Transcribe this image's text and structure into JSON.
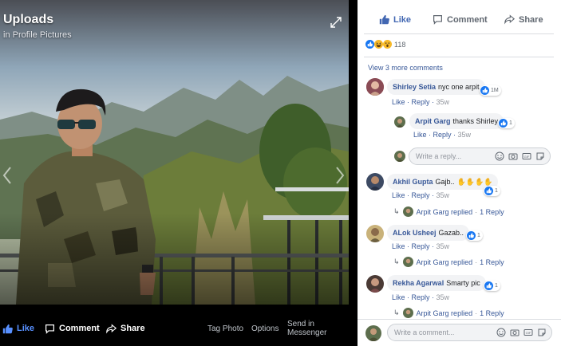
{
  "photo": {
    "title": "Uploads",
    "subtitle": "in Profile Pictures",
    "actions": {
      "like": "Like",
      "comment": "Comment",
      "share": "Share",
      "tag": "Tag Photo",
      "options": "Options",
      "messenger": "Send in Messenger"
    }
  },
  "panel": {
    "actions": {
      "like": "Like",
      "comment": "Comment",
      "share": "Share"
    },
    "reaction_count": "118",
    "view_more": "View 3 more comments",
    "comments": [
      {
        "name": "Shirley Setia",
        "text": "nyc one arpit",
        "reactions": "1M",
        "like": "Like",
        "reply": "Reply",
        "time": "35w"
      },
      {
        "name": "Arpit Garg",
        "text": "thanks Shirley",
        "reactions": "1",
        "like": "Like",
        "reply": "Reply",
        "time": "35w"
      },
      {
        "name": "Akhil Gupta",
        "text": "Gajb..",
        "reactions": "1",
        "like": "Like",
        "reply": "Reply",
        "time": "35w",
        "replied": "Arpit Garg replied",
        "replies": "1 Reply"
      },
      {
        "name": "ALok Usheej",
        "text": "Gazab..",
        "reactions": "1",
        "like": "Like",
        "reply": "Reply",
        "time": "35w",
        "replied": "Arpit Garg replied",
        "replies": "1 Reply"
      },
      {
        "name": "Rekha Agarwal",
        "text": "Smarty pic",
        "reactions": "1",
        "like": "Like",
        "reply": "Reply",
        "time": "35w",
        "replied": "Arpit Garg replied",
        "replies": "1 Reply"
      }
    ],
    "reply_placeholder": "Write a reply...",
    "comment_placeholder": "Write a comment..."
  },
  "colors": {
    "fb_blue": "#4267b2",
    "link": "#385898",
    "bubble": "#f2f3f5"
  }
}
